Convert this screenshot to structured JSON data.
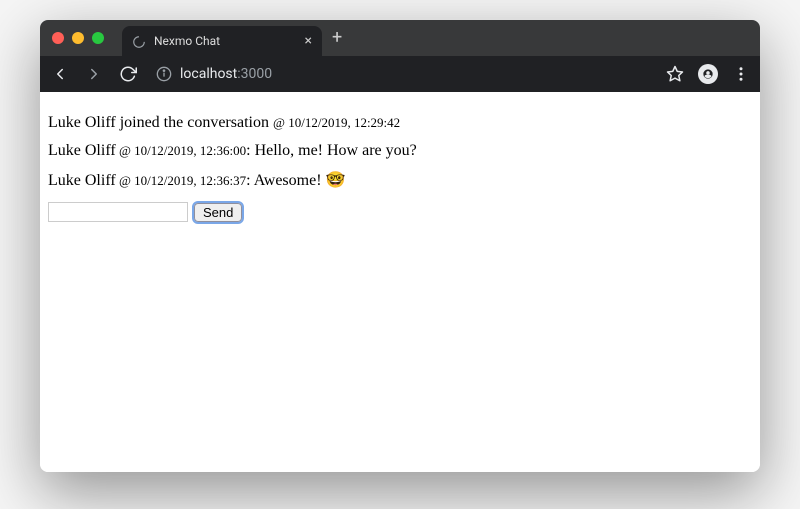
{
  "browser": {
    "tab_title": "Nexmo Chat",
    "url_host": "localhost",
    "url_port": ":3000"
  },
  "messages": [
    {
      "user": "Luke Oliff",
      "joined": true,
      "joined_text": " joined the conversation ",
      "at": "@ ",
      "timestamp": "10/12/2019, 12:29:42"
    },
    {
      "user": "Luke Oliff",
      "at": " @ ",
      "timestamp": "10/12/2019, 12:36:00",
      "sep": ": ",
      "text": "Hello, me! How are you?"
    },
    {
      "user": "Luke Oliff",
      "at": " @ ",
      "timestamp": "10/12/2019, 12:36:37",
      "sep": ": ",
      "text": "Awesome! ",
      "emoji": "🤓"
    }
  ],
  "compose": {
    "input_value": "",
    "send_label": "Send"
  }
}
